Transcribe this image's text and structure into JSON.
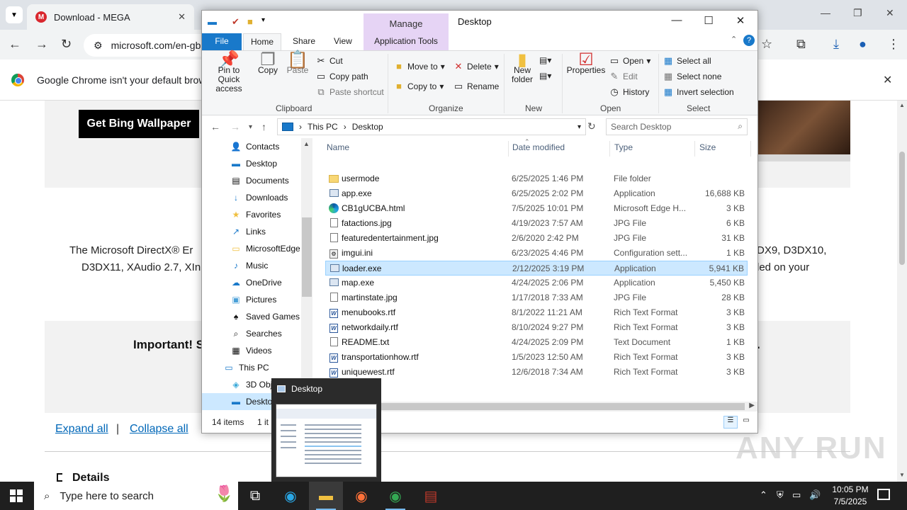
{
  "browser": {
    "tab_title": "Download - MEGA",
    "tab_close": "✕",
    "tab_list_icon": "chevron-down-icon",
    "url": "microsoft.com/en-gb",
    "infobar_text": "Google Chrome isn't your default browser",
    "window_controls": [
      "—",
      "❐",
      "✕"
    ]
  },
  "page": {
    "bing_button": "Get Bing Wallpaper",
    "description_line1_left": "The Microsoft DirectX® Er",
    "description_line1_right": "DX9, D3DX10,",
    "description_line2_left": "D3DX11, XAudio 2.7, XIn",
    "description_line2_right": "led on your",
    "important": "Important! S",
    "important_tail": ".",
    "expand_all": "Expand all",
    "separator": "|",
    "collapse_all": "Collapse all",
    "details": "Details",
    "watermark": "ANY RUN"
  },
  "explorer": {
    "manage_tab": "Manage",
    "title": "Desktop",
    "tabs": {
      "file": "File",
      "home": "Home",
      "share": "Share",
      "view": "View",
      "app_tools": "Application Tools"
    },
    "ribbon": {
      "pin": "Pin to Quick access",
      "copy": "Copy",
      "paste": "Paste",
      "cut": "Cut",
      "copy_path": "Copy path",
      "paste_shortcut": "Paste shortcut",
      "clipboard": "Clipboard",
      "move_to": "Move to",
      "copy_to": "Copy to",
      "delete": "Delete",
      "rename": "Rename",
      "organize": "Organize",
      "new_folder": "New folder",
      "new": "New",
      "properties": "Properties",
      "open": "Open",
      "edit": "Edit",
      "history": "History",
      "open_group": "Open",
      "select_all": "Select all",
      "select_none": "Select none",
      "invert_selection": "Invert selection",
      "select": "Select"
    },
    "address": {
      "this_pc": "This PC",
      "desktop": "Desktop",
      "sep": "›"
    },
    "search_placeholder": "Search Desktop",
    "nav_items": [
      {
        "label": "Contacts",
        "icon": "contacts-icon"
      },
      {
        "label": "Desktop",
        "icon": "desktop-icon"
      },
      {
        "label": "Documents",
        "icon": "documents-icon"
      },
      {
        "label": "Downloads",
        "icon": "downloads-icon"
      },
      {
        "label": "Favorites",
        "icon": "star-icon"
      },
      {
        "label": "Links",
        "icon": "link-icon"
      },
      {
        "label": "MicrosoftEdge",
        "icon": "folder-icon"
      },
      {
        "label": "Music",
        "icon": "music-icon"
      },
      {
        "label": "OneDrive",
        "icon": "cloud-icon"
      },
      {
        "label": "Pictures",
        "icon": "pictures-icon"
      },
      {
        "label": "Saved Games",
        "icon": "games-icon"
      },
      {
        "label": "Searches",
        "icon": "search-icon"
      },
      {
        "label": "Videos",
        "icon": "video-icon"
      },
      {
        "label": "This PC",
        "icon": "computer-icon"
      },
      {
        "label": "3D Objects",
        "icon": "cube-icon"
      },
      {
        "label": "Desktop",
        "icon": "desktop-icon"
      }
    ],
    "columns": {
      "name": "Name",
      "date": "Date modified",
      "type": "Type",
      "size": "Size"
    },
    "files": [
      {
        "name": "usermode",
        "date": "6/25/2025 1:46 PM",
        "type": "File folder",
        "size": "",
        "icon": "folder"
      },
      {
        "name": "app.exe",
        "date": "6/25/2025 2:02 PM",
        "type": "Application",
        "size": "16,688 KB",
        "icon": "exe"
      },
      {
        "name": "CB1gUCBA.html",
        "date": "7/5/2025 10:01 PM",
        "type": "Microsoft Edge H...",
        "size": "3 KB",
        "icon": "edge"
      },
      {
        "name": "fatactions.jpg",
        "date": "4/19/2023 7:57 AM",
        "type": "JPG File",
        "size": "6 KB",
        "icon": "file"
      },
      {
        "name": "featuredentertainment.jpg",
        "date": "2/6/2020 2:42 PM",
        "type": "JPG File",
        "size": "31 KB",
        "icon": "file"
      },
      {
        "name": "imgui.ini",
        "date": "6/23/2025 4:46 PM",
        "type": "Configuration sett...",
        "size": "1 KB",
        "icon": "cfg"
      },
      {
        "name": "loader.exe",
        "date": "2/12/2025 3:19 PM",
        "type": "Application",
        "size": "5,941 KB",
        "icon": "exe"
      },
      {
        "name": "map.exe",
        "date": "4/24/2025 2:06 PM",
        "type": "Application",
        "size": "5,450 KB",
        "icon": "exe"
      },
      {
        "name": "martinstate.jpg",
        "date": "1/17/2018 7:33 AM",
        "type": "JPG File",
        "size": "28 KB",
        "icon": "file"
      },
      {
        "name": "menubooks.rtf",
        "date": "8/1/2022 11:21 AM",
        "type": "Rich Text Format",
        "size": "3 KB",
        "icon": "rtf"
      },
      {
        "name": "networkdaily.rtf",
        "date": "8/10/2024 9:27 PM",
        "type": "Rich Text Format",
        "size": "3 KB",
        "icon": "rtf"
      },
      {
        "name": "README.txt",
        "date": "4/24/2025 2:09 PM",
        "type": "Text Document",
        "size": "1 KB",
        "icon": "file"
      },
      {
        "name": "transportationhow.rtf",
        "date": "1/5/2023 12:50 AM",
        "type": "Rich Text Format",
        "size": "3 KB",
        "icon": "rtf"
      },
      {
        "name": "uniquewest.rtf",
        "date": "12/6/2018 7:34 AM",
        "type": "Rich Text Format",
        "size": "3 KB",
        "icon": "rtf"
      }
    ],
    "status_items": "14 items",
    "status_selected": "1 it"
  },
  "thumbnail": {
    "title": "Desktop"
  },
  "taskbar": {
    "search_placeholder": "Type here to search",
    "time": "10:05 PM",
    "date": "7/5/2025"
  }
}
